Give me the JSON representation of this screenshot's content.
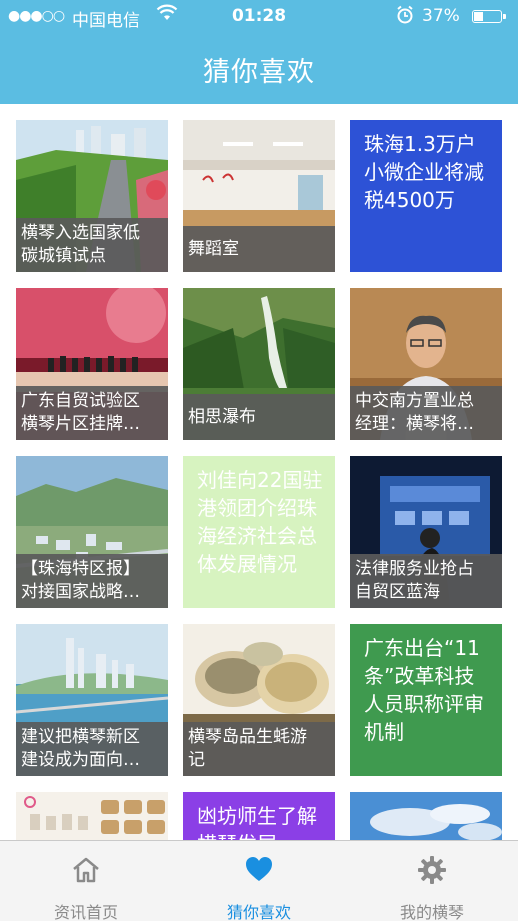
{
  "status_bar": {
    "signal": "●●●○○",
    "carrier": "中国电信",
    "time": "01:28",
    "battery_percent": "37%",
    "battery_level": 0.37,
    "icons": [
      "wifi-icon",
      "alarm-icon",
      "battery-icon"
    ]
  },
  "nav": {
    "title": "猜你喜欢"
  },
  "grid": {
    "tiles": [
      {
        "kind": "photo",
        "caption_1": "横琴入选国家低",
        "caption_2": "碳城镇试点"
      },
      {
        "kind": "photo",
        "caption_1": "舞蹈室"
      },
      {
        "kind": "text",
        "text": "珠海1.3万户小微企业将减税4500万",
        "bg": "#2d52d6"
      },
      {
        "kind": "photo",
        "caption_1": "广东自贸试验区",
        "caption_2": "横琴片区挂牌…"
      },
      {
        "kind": "photo",
        "caption_1": "相思瀑布"
      },
      {
        "kind": "photo",
        "caption_1": "中交南方置业总",
        "caption_2": "经理：横琴将…"
      },
      {
        "kind": "photo",
        "caption_1": "【珠海特区报】",
        "caption_2": "对接国家战略…"
      },
      {
        "kind": "text",
        "text": "刘佳向22国驻港领团介绍珠海经济社会总体发展情况",
        "bg": "#d7f3c0"
      },
      {
        "kind": "photo",
        "caption_1": "法律服务业抢占",
        "caption_2": "自贸区蓝海"
      },
      {
        "kind": "photo",
        "caption_1": "建议把横琴新区",
        "caption_2": "建设成为面向…"
      },
      {
        "kind": "photo",
        "caption_1": "横琴岛品生蚝游",
        "caption_2": "记"
      },
      {
        "kind": "text",
        "text": "广东出台“11条”改革科技人员职称评审机制",
        "bg": "#3f9a4f"
      },
      {
        "kind": "photo"
      },
      {
        "kind": "text",
        "text": "凼坊师生了解横琴发展",
        "bg": "#8b3fe6"
      },
      {
        "kind": "photo"
      }
    ]
  },
  "tabbar": {
    "tabs": [
      {
        "label": "资讯首页",
        "icon": "home-icon"
      },
      {
        "label": "猜你喜欢",
        "icon": "heart-icon",
        "active": true
      },
      {
        "label": "我的横琴",
        "icon": "gear-icon"
      }
    ],
    "active_color": "#1a8fe0"
  }
}
